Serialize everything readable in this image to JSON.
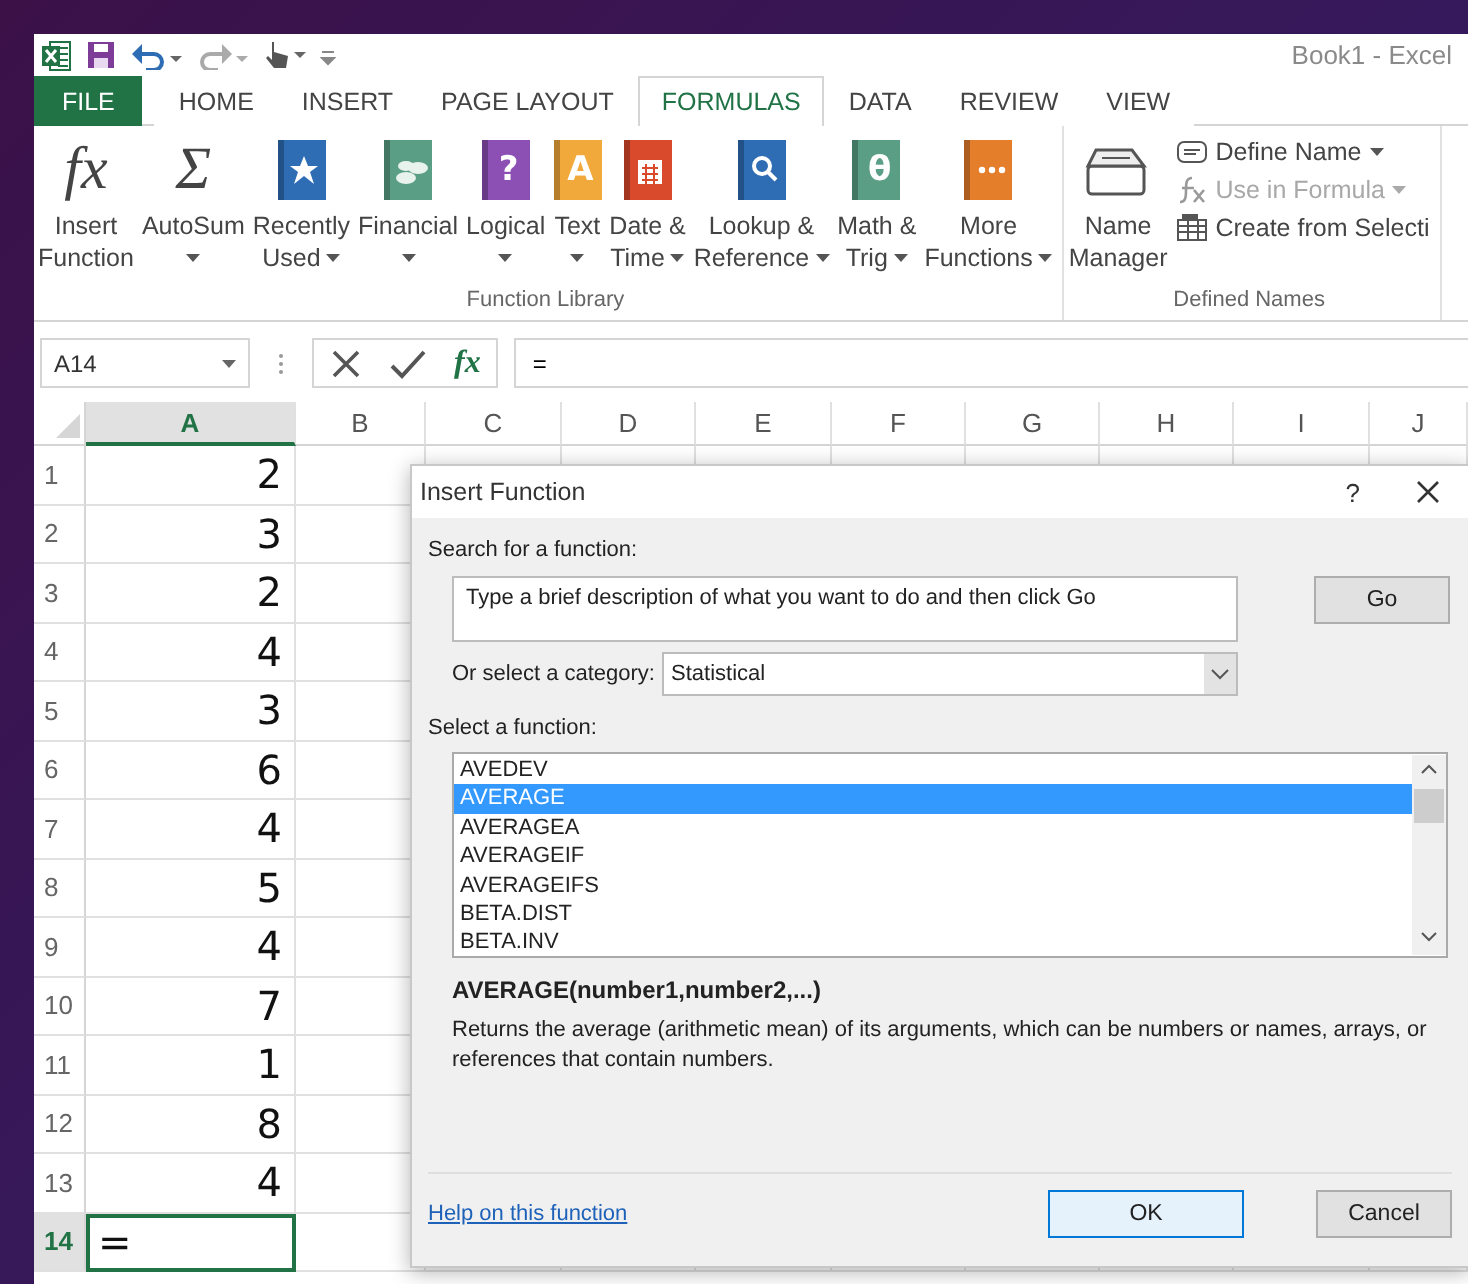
{
  "window": {
    "title": "Book1 - Excel"
  },
  "tabs": [
    {
      "label": "FILE",
      "kind": "file",
      "selected": false
    },
    {
      "label": "HOME",
      "kind": "tab",
      "selected": false
    },
    {
      "label": "INSERT",
      "kind": "tab",
      "selected": false
    },
    {
      "label": "PAGE LAYOUT",
      "kind": "tab",
      "selected": false
    },
    {
      "label": "FORMULAS",
      "kind": "tab",
      "selected": true
    },
    {
      "label": "DATA",
      "kind": "tab",
      "selected": false
    },
    {
      "label": "REVIEW",
      "kind": "tab",
      "selected": false
    },
    {
      "label": "VIEW",
      "kind": "tab",
      "selected": false
    }
  ],
  "ribbon": {
    "groups": [
      {
        "label": "Function Library",
        "buttons": [
          {
            "kind": "insert",
            "glyph": "fx",
            "lines": [
              "Insert",
              "Function"
            ],
            "dropdown": false
          },
          {
            "kind": "autosum",
            "glyph": "Σ",
            "lines": [
              "AutoSum"
            ],
            "dropdown": true
          },
          {
            "kind": "recent",
            "color": "#2e6db4",
            "lines": [
              "Recently",
              "Used"
            ],
            "dropdown": true
          },
          {
            "kind": "financial",
            "color": "#5b9e86",
            "lines": [
              "Financial"
            ],
            "dropdown": true
          },
          {
            "kind": "logical",
            "glyph": "?",
            "color": "#8c4fb3",
            "lines": [
              "Logical"
            ],
            "dropdown": true
          },
          {
            "kind": "text",
            "glyph": "A",
            "color": "#f2a93b",
            "lines": [
              "Text"
            ],
            "dropdown": true
          },
          {
            "kind": "datetime",
            "color": "#d9492c",
            "lines": [
              "Date &",
              "Time"
            ],
            "dropdown": true
          },
          {
            "kind": "lookup",
            "color": "#2e6db4",
            "lines": [
              "Lookup &",
              "Reference"
            ],
            "dropdown": true
          },
          {
            "kind": "math",
            "glyph": "θ",
            "color": "#5b9e86",
            "lines": [
              "Math &",
              "Trig"
            ],
            "dropdown": true
          },
          {
            "kind": "more",
            "color": "#e57e2b",
            "lines": [
              "More",
              "Functions"
            ],
            "dropdown": true
          }
        ]
      },
      {
        "label": "Defined Names",
        "buttons": [
          {
            "kind": "manager",
            "lines": [
              "Name",
              "Manager"
            ],
            "dropdown": false
          },
          {
            "kind": "define",
            "label": "Define Name",
            "dropdown": true,
            "disabled": false
          },
          {
            "kind": "use",
            "label": "Use in Formula",
            "dropdown": true,
            "disabled": true
          },
          {
            "kind": "create",
            "label": "Create from Selecti",
            "dropdown": false,
            "disabled": false
          }
        ]
      }
    ]
  },
  "formula_bar": {
    "name_box": "A14",
    "function_glyph": "fx",
    "formula": "="
  },
  "sheet": {
    "columns": [
      {
        "label": "A",
        "selected": true
      },
      {
        "label": "B",
        "selected": false
      },
      {
        "label": "C",
        "selected": false
      },
      {
        "label": "D",
        "selected": false
      },
      {
        "label": "E",
        "selected": false
      },
      {
        "label": "F",
        "selected": false
      },
      {
        "label": "G",
        "selected": false
      },
      {
        "label": "H",
        "selected": false
      },
      {
        "label": "I",
        "selected": false
      },
      {
        "label": "J",
        "selected": false
      }
    ],
    "rows": [
      {
        "number": "1",
        "a": "2",
        "selected": false
      },
      {
        "number": "2",
        "a": "3",
        "selected": false
      },
      {
        "number": "3",
        "a": "2",
        "selected": false
      },
      {
        "number": "4",
        "a": "4",
        "selected": false
      },
      {
        "number": "5",
        "a": "3",
        "selected": false
      },
      {
        "number": "6",
        "a": "6",
        "selected": false
      },
      {
        "number": "7",
        "a": "4",
        "selected": false
      },
      {
        "number": "8",
        "a": "5",
        "selected": false
      },
      {
        "number": "9",
        "a": "4",
        "selected": false
      },
      {
        "number": "10",
        "a": "7",
        "selected": false
      },
      {
        "number": "11",
        "a": "1",
        "selected": false
      },
      {
        "number": "12",
        "a": "8",
        "selected": false
      },
      {
        "number": "13",
        "a": "4",
        "selected": false
      },
      {
        "number": "14",
        "a": "=",
        "selected": true
      }
    ]
  },
  "dialog": {
    "title": "Insert Function",
    "help_button": "?",
    "search": {
      "label": "Search for a function:",
      "value": "Type a brief description of what you want to do and then click Go",
      "button": "Go"
    },
    "category": {
      "label": "Or select a category:",
      "value": "Statistical"
    },
    "function_list": {
      "label": "Select a function:",
      "items": [
        {
          "name": "AVEDEV",
          "selected": false
        },
        {
          "name": "AVERAGE",
          "selected": true
        },
        {
          "name": "AVERAGEA",
          "selected": false
        },
        {
          "name": "AVERAGEIF",
          "selected": false
        },
        {
          "name": "AVERAGEIFS",
          "selected": false
        },
        {
          "name": "BETA.DIST",
          "selected": false
        },
        {
          "name": "BETA.INV",
          "selected": false
        }
      ]
    },
    "signature": "AVERAGE(number1,number2,...)",
    "description": "Returns the average (arithmetic mean) of its arguments, which can be numbers or names, arrays, or references that contain numbers.",
    "help_link": "Help on this function",
    "buttons": [
      {
        "label": "OK",
        "default": true
      },
      {
        "label": "Cancel",
        "default": false
      }
    ]
  }
}
